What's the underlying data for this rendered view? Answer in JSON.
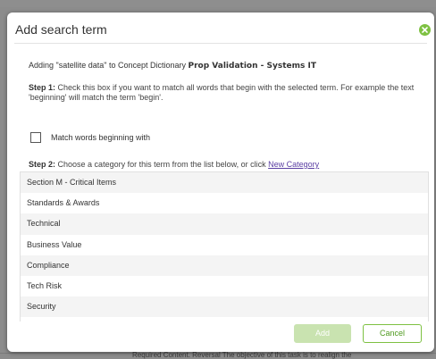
{
  "dialog": {
    "title": "Add search term",
    "intro_prefix": "Adding \"satellite data\" to Concept Dictionary ",
    "intro_dictionary": "Prop Validation - Systems IT",
    "step1_label": "Step 1:",
    "step1_text": "Check this box if you want to match all words that begin with the selected term. For example the text 'beginning' will match the term 'begin'.",
    "checkbox_label": "Match words beginning with",
    "checkbox_checked": false,
    "step2_label": "Step 2:",
    "step2_text": "Choose a category for this term from the list below, or click ",
    "new_category_link": "New Category",
    "categories": [
      "Section M - Critical Items",
      "Standards & Awards",
      "Technical",
      "Business Value",
      "Compliance",
      "Tech Risk",
      "Security"
    ],
    "add_button": "Add",
    "cancel_button": "Cancel",
    "close_icon": "close-icon",
    "accent_color": "#7ec142"
  },
  "background": {
    "text": "Required Content. Reversal The objective of this task is to realign the"
  }
}
